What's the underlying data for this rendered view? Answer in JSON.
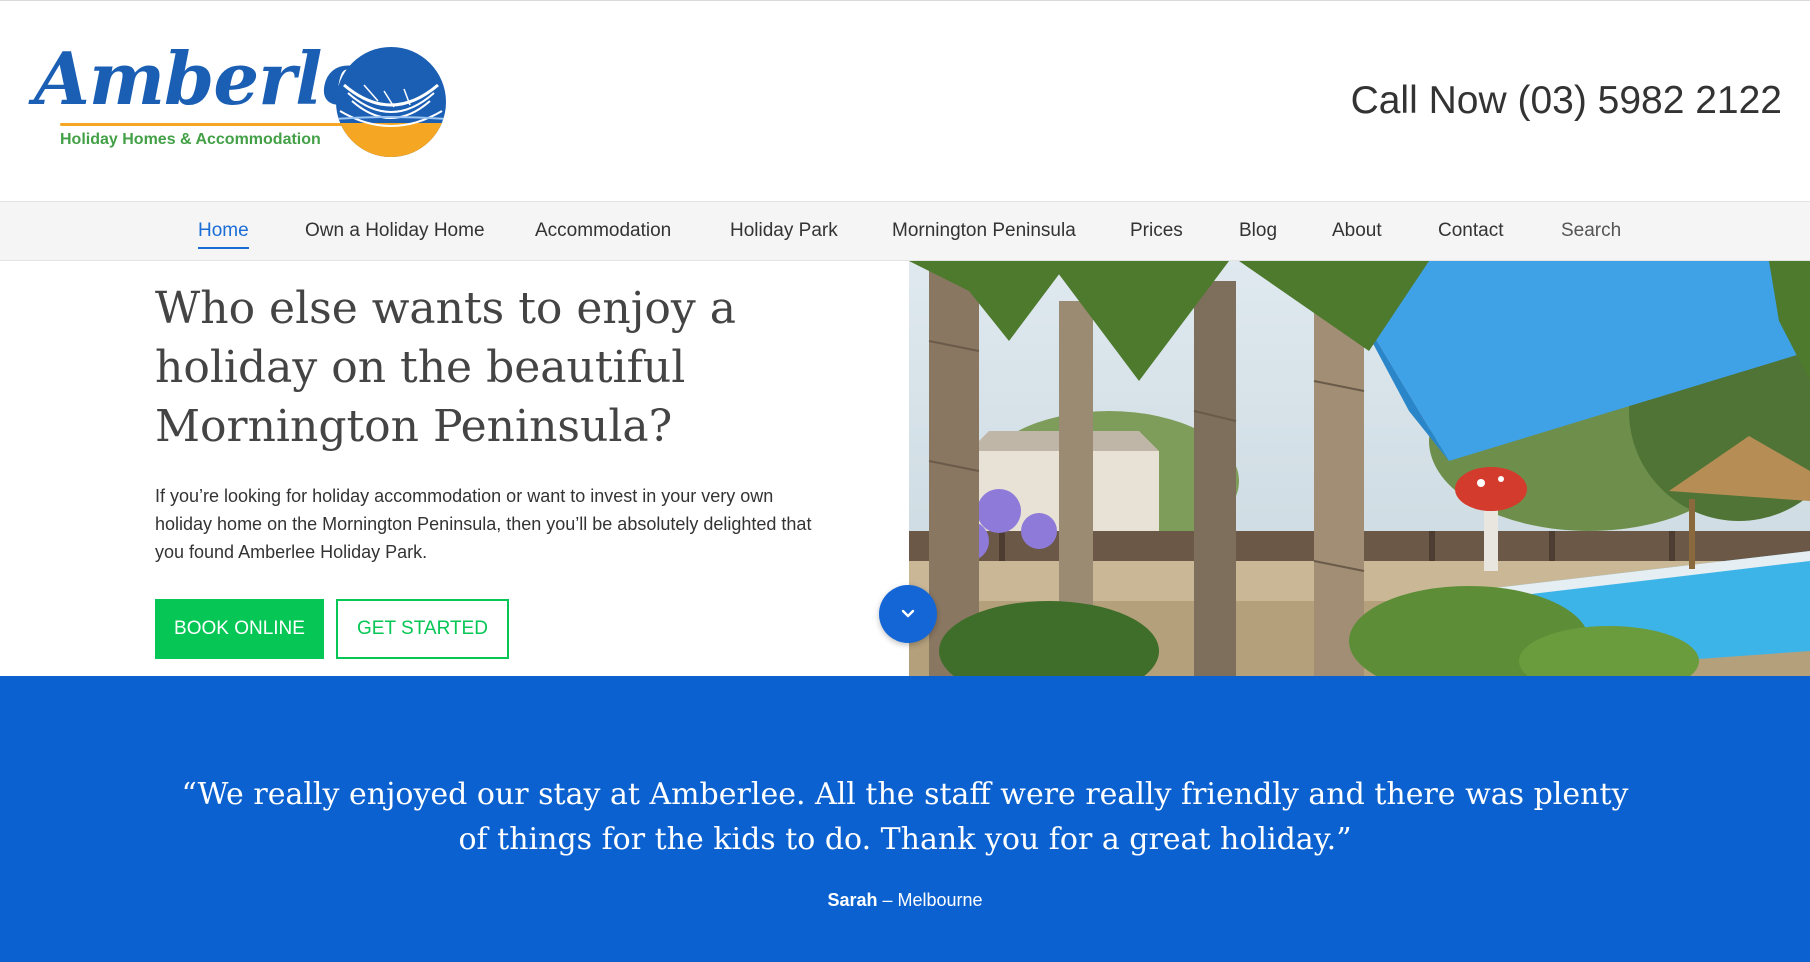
{
  "header": {
    "logo_word": "Amberlee",
    "logo_tagline": "Holiday Homes & Accommodation",
    "call_now": "Call Now (03) 5982 2122"
  },
  "nav": {
    "items": [
      {
        "label": "Home",
        "active": true
      },
      {
        "label": "Own a Holiday Home"
      },
      {
        "label": "Accommodation"
      },
      {
        "label": "Holiday Park"
      },
      {
        "label": "Mornington Peninsula"
      },
      {
        "label": "Prices"
      },
      {
        "label": "Blog"
      },
      {
        "label": "About"
      },
      {
        "label": "Contact"
      },
      {
        "label": "Search"
      }
    ]
  },
  "hero": {
    "title": "Who else wants to enjoy a holiday on the beautiful Mornington Peninsula?",
    "text": "If you’re looking for holiday accommodation or want to invest in your very own holiday home on the Mornington Peninsula, then you’ll be absolutely delighted that you found Amberlee Holiday Park.",
    "book_label": "BOOK ONLINE",
    "start_label": "GET STARTED"
  },
  "scroll_icon": "chevron-down-icon",
  "testimonial": {
    "quote": "“We really enjoyed our stay at Amberlee. All the staff were really friendly and there was plenty of things for the kids to do. Thank you for a great holiday.”",
    "author_name": "Sarah",
    "author_sep": " – ",
    "author_place": "Melbourne"
  },
  "colors": {
    "brand_blue": "#1a5fb4",
    "nav_active": "#1a6dd6",
    "cta_green": "#06c755",
    "band_blue": "#0a61cf",
    "logo_orange": "#f5a623",
    "logo_green": "#43a047"
  }
}
